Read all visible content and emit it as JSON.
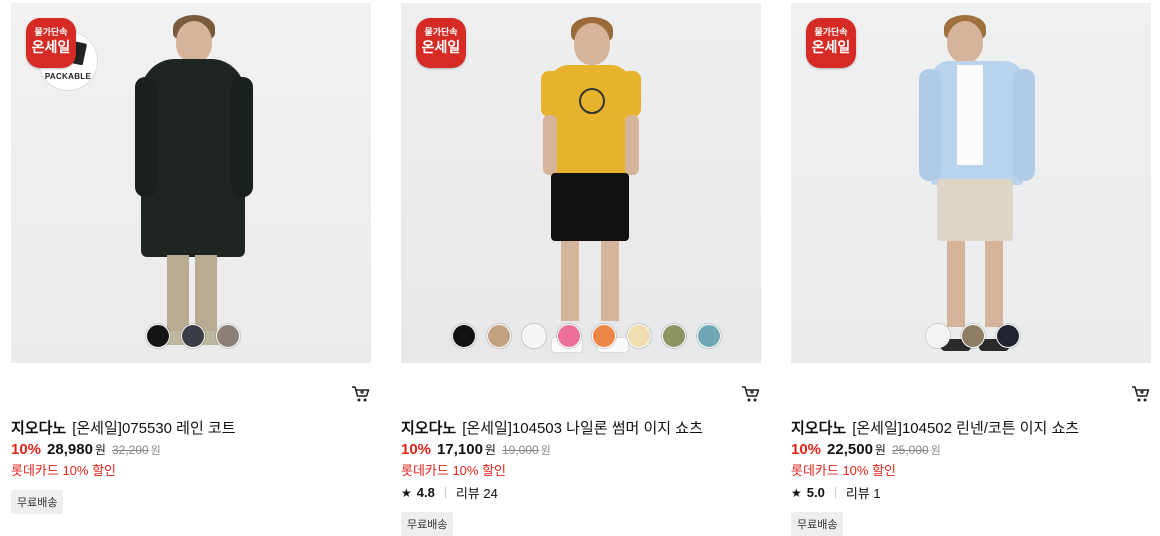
{
  "products": [
    {
      "badge": {
        "line1": "물가단속",
        "line2": "온세일"
      },
      "packable_label": "PACKABLE",
      "brand": "지오다노",
      "name": "[온세일]075530 레인 코트",
      "discount": "10%",
      "price": "28,980",
      "currency": "원",
      "original_price": "32,200",
      "original_currency": "원",
      "benefit": "롯데카드 10% 할인",
      "tag": "무료배송",
      "swatches": [
        "#141414",
        "#3a3d44",
        "#8b7f76"
      ]
    },
    {
      "badge": {
        "line1": "물가단속",
        "line2": "온세일"
      },
      "brand": "지오다노",
      "name": "[온세일]104503 나일론 썸머 이지 쇼츠",
      "discount": "10%",
      "price": "17,100",
      "currency": "원",
      "original_price": "19,000",
      "original_currency": "원",
      "benefit": "롯데카드 10% 할인",
      "rating": "4.8",
      "review_label": "리뷰 24",
      "tag": "무료배송",
      "swatches": [
        "#111111",
        "#c2a27f",
        "#f4f4f4",
        "#ec6f9b",
        "#ee8746",
        "#f0dcae",
        "#8d9462",
        "#6fa7b5"
      ]
    },
    {
      "badge": {
        "line1": "물가단속",
        "line2": "온세일"
      },
      "brand": "지오다노",
      "name": "[온세일]104502 린넨/코튼 이지 쇼츠",
      "discount": "10%",
      "price": "22,500",
      "currency": "원",
      "original_price": "25,000",
      "original_currency": "원",
      "benefit": "롯데카드 10% 할인",
      "rating": "5.0",
      "review_label": "리뷰 1",
      "tag": "무료배송",
      "swatches": [
        "#f3f3f3",
        "#8d7d62",
        "#1f2430"
      ]
    }
  ],
  "icons": {
    "cart": "cart-icon",
    "star": "star-icon"
  },
  "colors": {
    "accent_red": "#e1251b",
    "badge_red": "#d52b24"
  }
}
